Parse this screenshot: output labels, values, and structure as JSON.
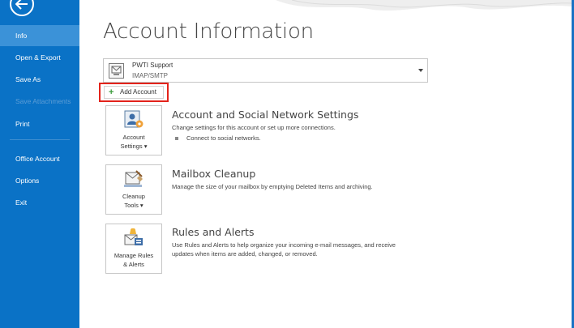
{
  "sidebar": {
    "items": [
      {
        "label": "Info"
      },
      {
        "label": "Open & Export"
      },
      {
        "label": "Save As"
      },
      {
        "label": "Save Attachments"
      },
      {
        "label": "Print"
      },
      {
        "label": "Office Account"
      },
      {
        "label": "Options"
      },
      {
        "label": "Exit"
      }
    ]
  },
  "page": {
    "title": "Account Information"
  },
  "account": {
    "name": "PWTI Support",
    "type": "IMAP/SMTP"
  },
  "add_account": {
    "label": "Add Account"
  },
  "sections": [
    {
      "tile_line1": "Account",
      "tile_line2": "Settings",
      "title": "Account and Social Network Settings",
      "description": "Change settings for this account or set up more connections.",
      "sub_item": "Connect to social networks."
    },
    {
      "tile_line1": "Cleanup",
      "tile_line2": "Tools",
      "title": "Mailbox Cleanup",
      "description": "Manage the size of your mailbox by emptying Deleted Items and archiving."
    },
    {
      "tile_line1": "Manage Rules",
      "tile_line2": "& Alerts",
      "title": "Rules and Alerts",
      "description": "Use Rules and Alerts to help organize your incoming e-mail messages, and receive",
      "description2": "updates when items are added, changed, or removed."
    }
  ],
  "colors": {
    "sidebar": "#0a72c6",
    "active_item": "#3b92d8",
    "highlight": "#e3231b"
  }
}
